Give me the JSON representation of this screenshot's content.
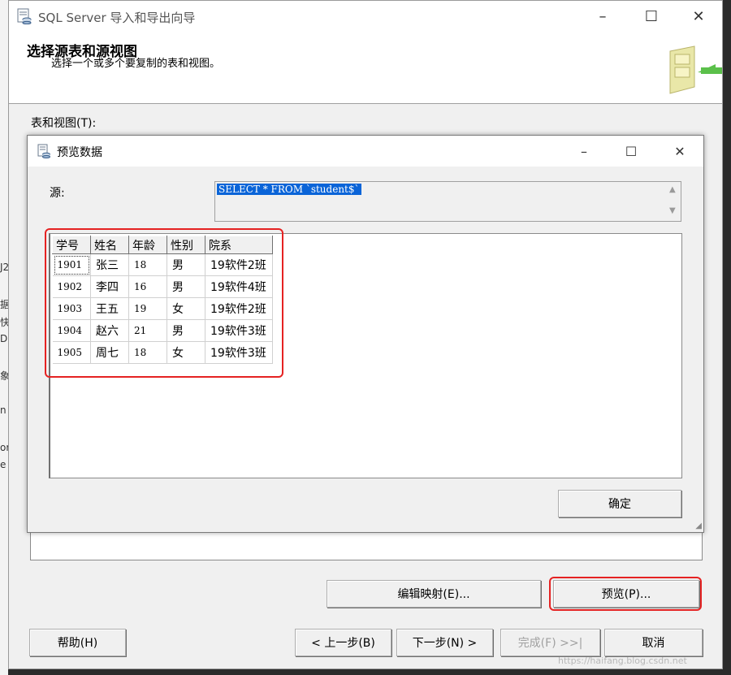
{
  "background_fragments": [
    "J2",
    "据",
    "快",
    "D",
    "象",
    "n",
    "or",
    "e"
  ],
  "window": {
    "title": "SQL Server 导入和导出向导",
    "controls": {
      "minimize": "–",
      "maximize": "☐",
      "close": "✕"
    }
  },
  "header": {
    "title": "选择源表和源视图",
    "subtitle": "选择一个或多个要复制的表和视图。"
  },
  "tables_label": "表和视图(T):",
  "dialog": {
    "title": "预览数据",
    "controls": {
      "minimize": "–",
      "maximize": "☐",
      "close": "✕"
    },
    "source_label": "源:",
    "sql": "SELECT * FROM `student$`",
    "columns": [
      "学号",
      "姓名",
      "年龄",
      "性别",
      "院系"
    ],
    "rows": [
      [
        "1901",
        "张三",
        "18",
        "男",
        "19软件2班"
      ],
      [
        "1902",
        "李四",
        "16",
        "男",
        "19软件4班"
      ],
      [
        "1903",
        "王五",
        "19",
        "女",
        "19软件2班"
      ],
      [
        "1904",
        "赵六",
        "21",
        "男",
        "19软件3班"
      ],
      [
        "1905",
        "周七",
        "18",
        "女",
        "19软件3班"
      ]
    ],
    "ok_label": "确定"
  },
  "buttons": {
    "edit_mappings": "编辑映射(E)...",
    "preview": "预览(P)...",
    "help": "帮助(H)",
    "back": "< 上一步(B)",
    "next": "下一步(N) >",
    "finish": "完成(F) >>|",
    "cancel": "取消"
  },
  "watermark": "https://haifang.blog.csdn.net",
  "colors": {
    "highlight_box": "#e52222",
    "selection": "#0a64d8"
  }
}
